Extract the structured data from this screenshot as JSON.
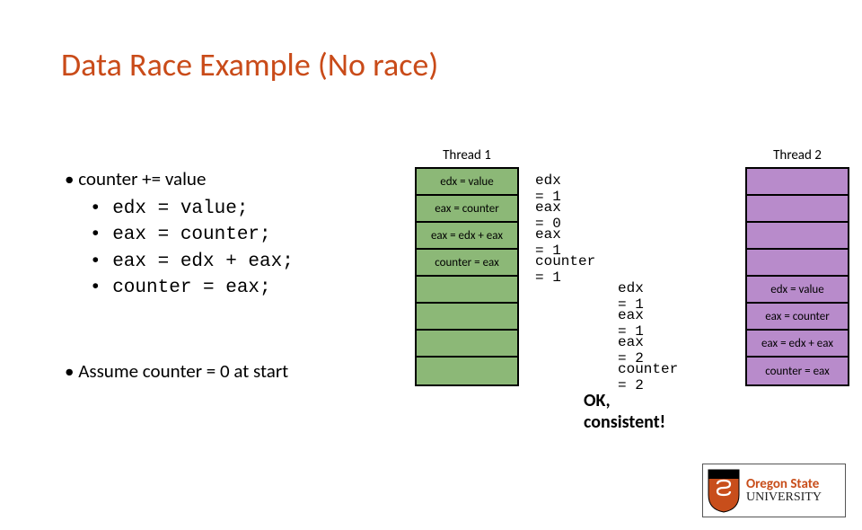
{
  "title": "Data Race Example (No race)",
  "left": {
    "heading": "• counter += value",
    "lines": [
      "• edx = value;",
      "• eax = counter;",
      "• eax = edx + eax;",
      "• counter = eax;"
    ],
    "assume": "• Assume counter = 0 at start"
  },
  "headers": {
    "t1": "Thread 1",
    "t2": "Thread 2"
  },
  "thread1_ops": [
    "edx = value",
    "eax = counter",
    "eax = edx + eax",
    "counter = eax"
  ],
  "thread2_ops": [
    "edx = value",
    "eax = counter",
    "eax = edx + eax",
    "counter = eax"
  ],
  "states_t1": [
    "edx = 1",
    "eax = 0",
    "eax = 1",
    "counter = 1"
  ],
  "states_t2": [
    "edx = 1",
    "eax = 1",
    "eax = 2",
    "counter = 2"
  ],
  "ok": "OK, consistent!",
  "logo": {
    "top": "Oregon State",
    "bottom": "UNIVERSITY"
  }
}
